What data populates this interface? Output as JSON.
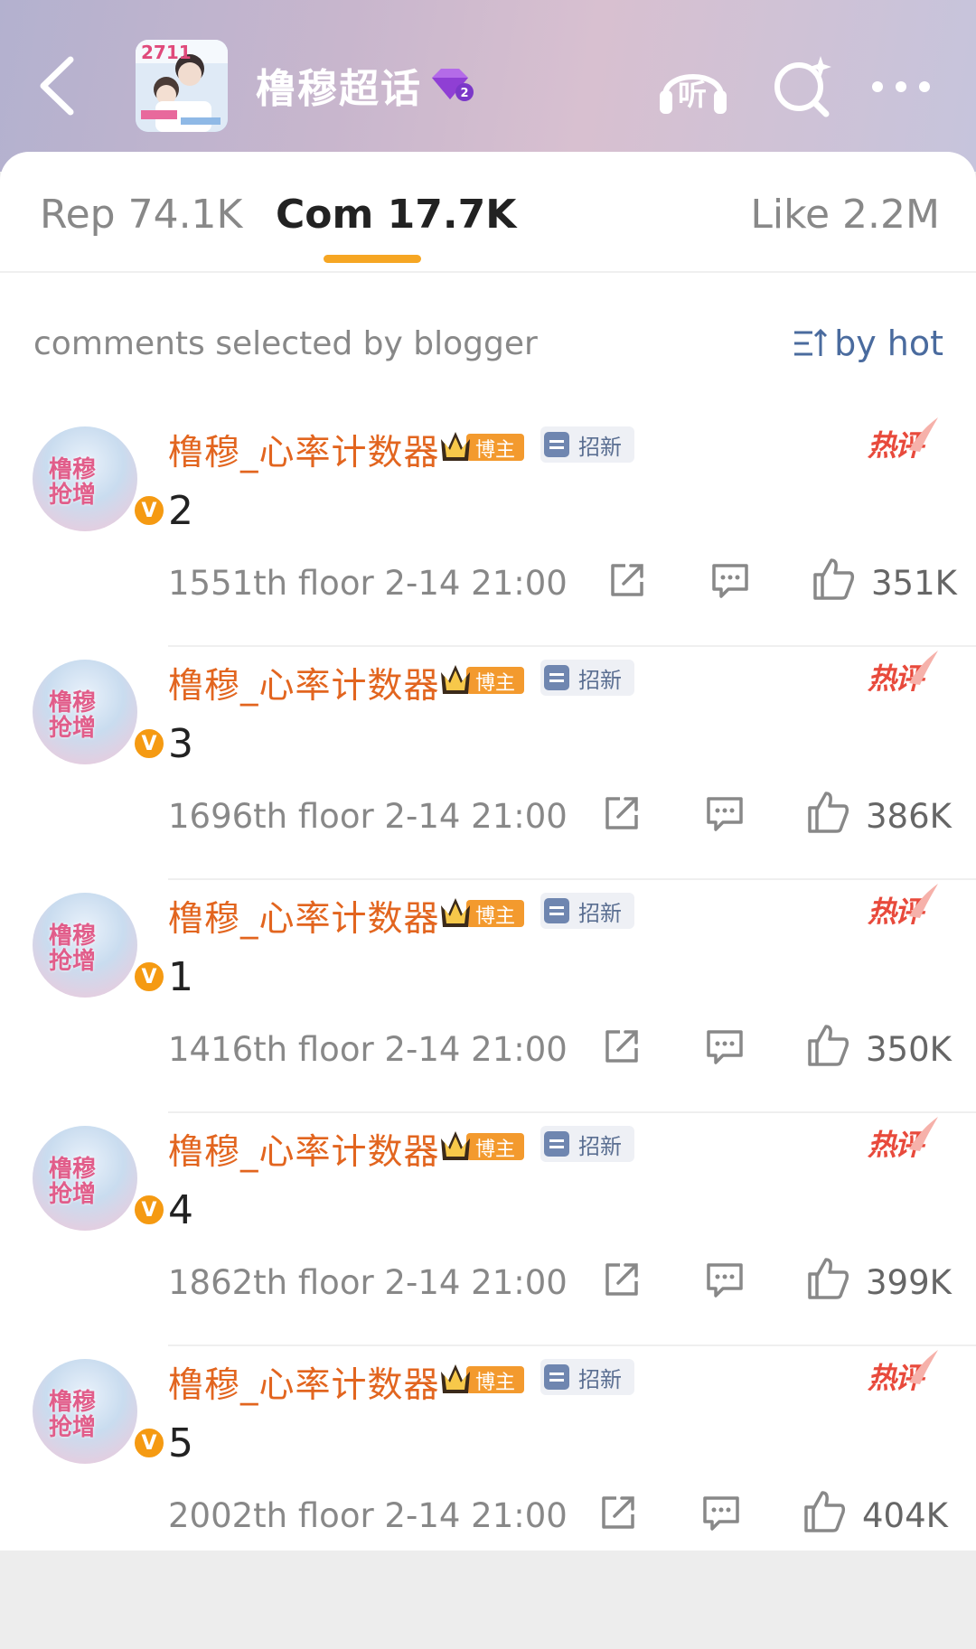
{
  "header": {
    "channel_title": "橹穆超话",
    "thumb_text": "2711",
    "back_icon": "chevron-left-icon",
    "listen_label": "听",
    "search_icon": "search-sparkle-icon",
    "more_icon": "ellipsis-icon"
  },
  "tabs": {
    "rep": "Rep 74.1K",
    "com": "Com 17.7K",
    "like": "Like 2.2M"
  },
  "section": {
    "label": "comments selected by blogger",
    "sort_label": "by hot"
  },
  "badges": {
    "crown_label": "博主",
    "recruit_label": "招新",
    "hot_label": "热评"
  },
  "colors": {
    "accent": "#f6a623",
    "username": "#e2651f",
    "hot": "#e84a3c",
    "link": "#4a6b9e"
  },
  "comments": [
    {
      "username": "橹穆_心率计数器",
      "text": "2",
      "meta": "1551th floor 2-14 21:00",
      "likes": "351K"
    },
    {
      "username": "橹穆_心率计数器",
      "text": "3",
      "meta": "1696th floor 2-14 21:00",
      "likes": "386K"
    },
    {
      "username": "橹穆_心率计数器",
      "text": "1",
      "meta": "1416th floor 2-14 21:00",
      "likes": "350K"
    },
    {
      "username": "橹穆_心率计数器",
      "text": "4",
      "meta": "1862th floor 2-14 21:00",
      "likes": "399K"
    },
    {
      "username": "橹穆_心率计数器",
      "text": "5",
      "meta": "2002th floor 2-14 21:00",
      "likes": "404K"
    }
  ]
}
